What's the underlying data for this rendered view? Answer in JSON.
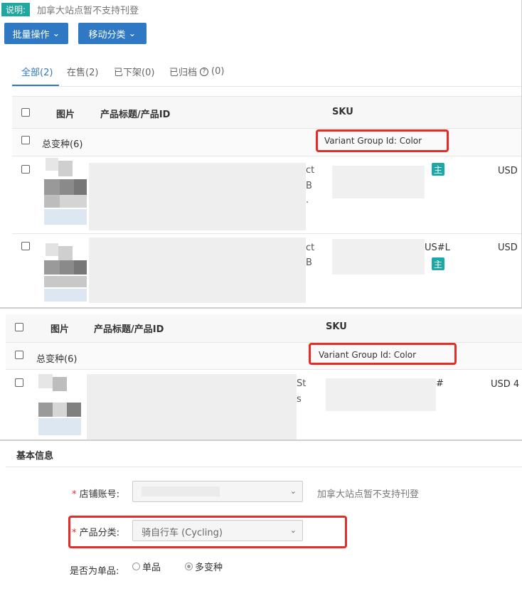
{
  "top_notice": {
    "tag": "说明:",
    "text": "加拿大站点暂不支持刊登"
  },
  "toolbar": {
    "batch_label": "批量操作",
    "move_label": "移动分类"
  },
  "tabs": [
    {
      "label": "全部(2)"
    },
    {
      "label": "在售(2)"
    },
    {
      "label": "已下架(0)"
    },
    {
      "label": "已归档",
      "suffix": "(0)"
    }
  ],
  "table1": {
    "headers": {
      "image": "图片",
      "title": "产品标题/产品ID",
      "sku": "SKU"
    },
    "group_row": {
      "label": "总变种(6)",
      "variant": "Variant Group Id: Color"
    },
    "rows": [
      {
        "frag1": "ct",
        "frag2": "B",
        "frag3": ".",
        "sku_suffix": "",
        "badge": "主",
        "price": "USD"
      },
      {
        "frag1": "ct",
        "frag2": "B",
        "frag3": "",
        "sku_suffix": "US#L",
        "badge": "主",
        "price": "USD"
      }
    ]
  },
  "table2": {
    "headers": {
      "image": "图片",
      "title": "产品标题/产品ID",
      "sku": "SKU"
    },
    "group_row": {
      "label": "总变种(6)",
      "variant": "Variant Group Id: Color"
    },
    "rows": [
      {
        "frag1": "St",
        "frag2": "s",
        "sku_suffix": "#",
        "price": "USD 4"
      }
    ]
  },
  "form": {
    "section_title": "基本信息",
    "store": {
      "label": "店铺账号:",
      "value": "",
      "note": "加拿大站点暂不支持刊登"
    },
    "category": {
      "label": "产品分类:",
      "value": "骑自行车 (Cycling)"
    },
    "single": {
      "label": "是否为单品:",
      "option_single": "单品",
      "option_multi": "多变种"
    }
  },
  "colors": {
    "accent": "#2f78c4",
    "teal": "#20a8a0",
    "highlight": "#e52d27"
  },
  "icons": [
    "chevron-down-icon",
    "help-circle-icon",
    "checkbox-icon",
    "radio-icon"
  ]
}
